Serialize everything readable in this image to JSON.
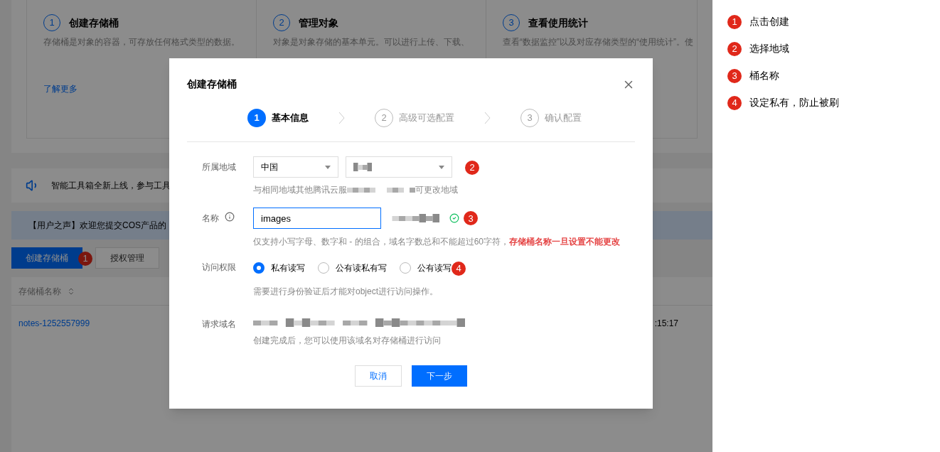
{
  "background": {
    "intro_cards": [
      {
        "number": "1",
        "title": "创建存储桶",
        "lines": [
          "存储桶是对象的容器，可存放任何格式类型的数据。"
        ],
        "link": "了解更多"
      },
      {
        "number": "2",
        "title": "管理对象",
        "lines": [
          "对象是对象存储的基本单元。可以进行上传、下载、"
        ]
      },
      {
        "number": "3",
        "title": "查看使用统计",
        "lines": [
          "查看“数据监控”以及对应存储类型的“使用统计”。使"
        ]
      }
    ],
    "notice": {
      "text": "智能工具箱全新上线，参与工具"
    },
    "banner": {
      "text": "【用户之声】欢迎您提交COS产品的"
    },
    "buttons": [
      {
        "label": "创建存储桶",
        "kind": "primary",
        "marker": "1"
      },
      {
        "label": "授权管理",
        "kind": "secondary"
      }
    ],
    "table": {
      "columns": [
        {
          "label": "存储桶名称"
        }
      ],
      "rows": [
        {
          "name": "notes-1252557999",
          "column_2": ":15:17"
        }
      ]
    }
  },
  "dialog": {
    "title": "创建存储桶",
    "steps": [
      {
        "number": "1",
        "label": "基本信息",
        "selected": true
      },
      {
        "number": "2",
        "label": "高级可选配置",
        "selected": false
      },
      {
        "number": "3",
        "label": "确认配置",
        "selected": false
      }
    ],
    "region": {
      "label": "所属地域",
      "country": "中国",
      "marker": "2",
      "hint_start": "与相同地域其他腾讯云服",
      "hint_end": "可更改地域"
    },
    "name": {
      "label": "名称",
      "value": "images",
      "valid": true,
      "marker": "3",
      "hint": "仅支持小写字母、数字和 - 的组合，域名字数总和不能超过60字符，",
      "warning": "存储桶名称一旦设置不能更改"
    },
    "access": {
      "label": "访问权限",
      "marker": "4",
      "options": [
        {
          "label": "私有读写",
          "selected": true
        },
        {
          "label": "公有读私有写",
          "selected": false
        },
        {
          "label": "公有读写",
          "selected": false
        }
      ],
      "hint": "需要进行身份验证后才能对object进行访问操作。"
    },
    "domain": {
      "label": "请求域名",
      "hint": "创建完成后，您可以使用该域名对存储桶进行访问"
    },
    "buttons": [
      {
        "label": "取消",
        "kind": "secondary"
      },
      {
        "label": "下一步",
        "kind": "primary"
      }
    ]
  },
  "legend": [
    {
      "marker": "1",
      "label": "点击创建"
    },
    {
      "marker": "2",
      "label": "选择地域"
    },
    {
      "marker": "3",
      "label": "桶名称"
    },
    {
      "marker": "4",
      "label": "设定私有，防止被刷"
    }
  ]
}
